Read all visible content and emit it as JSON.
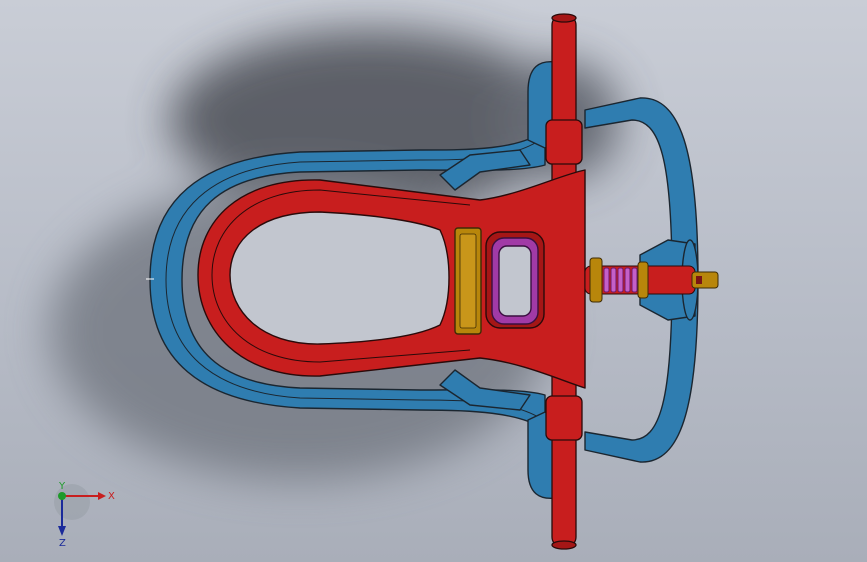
{
  "colors": {
    "background_top": "#c9cdd6",
    "background_bottom": "#a9aeb9",
    "frame_blue": "#2f7db0",
    "handle_red": "#c81e1e",
    "spring_magenta": "#a13aa6",
    "bronze": "#b8860b",
    "edge": "#1b2630"
  },
  "triad": {
    "x_label": "X",
    "y_label": "Y",
    "z_label": "Z"
  }
}
